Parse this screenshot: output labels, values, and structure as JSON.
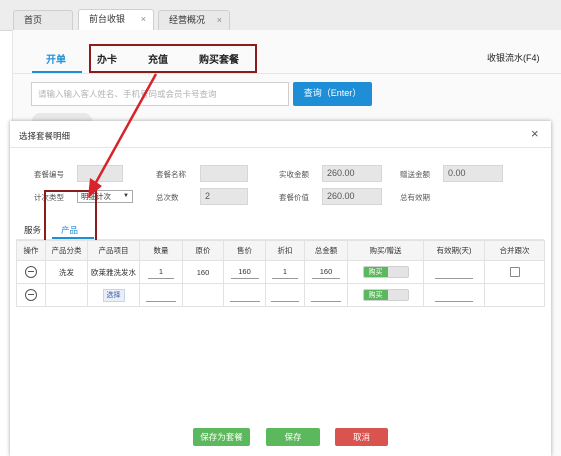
{
  "tabs": [
    {
      "label": "首页",
      "closable": false
    },
    {
      "label": "前台收银",
      "closable": true
    },
    {
      "label": "经营概况",
      "closable": true
    }
  ],
  "tab_close_glyph": "×",
  "nav": {
    "open_order": "开单",
    "card": "办卡",
    "recharge": "充值",
    "buy_package": "购买套餐",
    "cash_flow": "收银流水(F4)"
  },
  "search": {
    "placeholder": "请输入输入客人姓名、手机号码或会员卡号查询",
    "button": "查询（Enter）"
  },
  "modal": {
    "title": "选择套餐明细",
    "close": "×",
    "fields": {
      "pkg_no_label": "套餐编号",
      "pkg_no_value": "",
      "pkg_name_label": "套餐名称",
      "pkg_name_value": "",
      "actual_amount_label": "实收金额",
      "actual_amount_value": "260.00",
      "gift_amount_label": "赠送金额",
      "gift_amount_value": "0.00",
      "count_type_label": "计次类型",
      "count_type_value": "明细计次",
      "total_times_label": "总次数",
      "total_times_value": "2",
      "pkg_value_label": "套餐价值",
      "pkg_value_value": "260.00",
      "valid_total_label": "总有效期",
      "valid_total_value": ""
    },
    "inner_tabs": {
      "service": "服务",
      "product": "产品"
    },
    "table": {
      "headers": [
        "操作",
        "产品分类",
        "产品项目",
        "数量",
        "原价",
        "售价",
        "折扣",
        "总金额",
        "购买/赠送",
        "有效期(天)",
        "合并跟次"
      ],
      "rows": [
        {
          "category": "洗发",
          "item": "欧莱雅洗发水",
          "qty": "1",
          "orig_price": "160",
          "price": "160",
          "discount": "1",
          "total": "160",
          "buy_label": "购买",
          "validity": ""
        },
        {
          "category": "",
          "item": "选择",
          "qty": "",
          "orig_price": "",
          "price": "",
          "discount": "",
          "total": "",
          "buy_label": "购买",
          "validity": ""
        }
      ]
    },
    "footer": {
      "save_pkg": "保存为套餐",
      "save": "保存",
      "cancel": "取消"
    }
  },
  "colors": {
    "accent": "#1e8fd6",
    "green": "#5cb85c",
    "red": "#d9534f",
    "annotation": "#8b1c1c"
  }
}
